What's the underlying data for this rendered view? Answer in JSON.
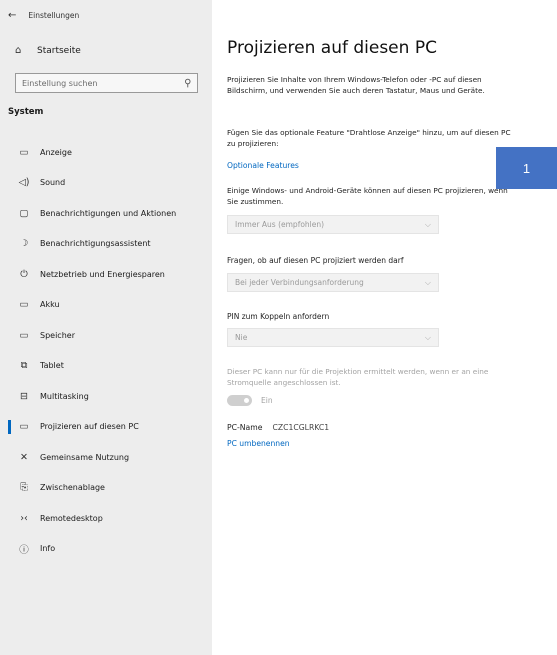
{
  "window": {
    "title": "Einstellungen",
    "back_glyph": "←"
  },
  "sidebar": {
    "home": {
      "label": "Startseite",
      "icon": "⌂"
    },
    "search": {
      "placeholder": "Einstellung suchen",
      "icon": "⚲"
    },
    "section_title": "System",
    "items": [
      {
        "label": "Anzeige",
        "icon": "▭",
        "icon_name": "monitor-icon"
      },
      {
        "label": "Sound",
        "icon": "◁)",
        "icon_name": "speaker-icon"
      },
      {
        "label": "Benachrichtigungen und Aktionen",
        "icon": "▢",
        "icon_name": "notification-icon"
      },
      {
        "label": "Benachrichtigungsassistent",
        "icon": "☽",
        "icon_name": "moon-icon"
      },
      {
        "label": "Netzbetrieb und Energiesparen",
        "icon": "⏻",
        "icon_name": "power-icon"
      },
      {
        "label": "Akku",
        "icon": "▭",
        "icon_name": "battery-icon"
      },
      {
        "label": "Speicher",
        "icon": "▭",
        "icon_name": "storage-icon"
      },
      {
        "label": "Tablet",
        "icon": "⧉",
        "icon_name": "tablet-icon"
      },
      {
        "label": "Multitasking",
        "icon": "⊟",
        "icon_name": "multitasking-icon"
      },
      {
        "label": "Projizieren auf diesen PC",
        "icon": "▭",
        "icon_name": "project-icon",
        "active": true
      },
      {
        "label": "Gemeinsame Nutzung",
        "icon": "✕",
        "icon_name": "share-icon"
      },
      {
        "label": "Zwischenablage",
        "icon": "⎘",
        "icon_name": "clipboard-icon"
      },
      {
        "label": "Remotedesktop",
        "icon": "›‹",
        "icon_name": "remote-desktop-icon"
      },
      {
        "label": "Info",
        "icon": "ⓘ",
        "icon_name": "info-icon"
      }
    ]
  },
  "main": {
    "title": "Projizieren auf diesen PC",
    "intro": "Projizieren Sie Inhalte von Ihrem Windows-Telefon oder -PC auf diesen Bildschirm, und verwenden Sie auch deren Tastatur, Maus und Geräte.",
    "feature_text": "Fügen Sie das optionale Feature \"Drahtlose Anzeige\" hinzu, um auf diesen PC zu projizieren:",
    "feature_link": "Optionale Features",
    "availability_text": "Einige Windows- und Android-Geräte können auf diesen PC projizieren, wenn Sie zustimmen.",
    "availability_value": "Immer Aus (empfohlen)",
    "ask_label": "Fragen, ob auf diesen PC projiziert werden darf",
    "ask_value": "Bei jeder Verbindungsanforderung",
    "pin_label": "PIN zum Koppeln anfordern",
    "pin_value": "Nie",
    "power_note": "Dieser PC kann nur für die Projektion ermittelt werden, wenn er an eine Stromquelle angeschlossen ist.",
    "toggle_label": "Ein",
    "pc_name_key": "PC-Name",
    "pc_name_value": "CZC1CGLRKC1",
    "rename_link": "PC umbenennen",
    "chevron": "⌵"
  },
  "badge": {
    "text": "1",
    "color": "#4472c4"
  },
  "colors": {
    "accent": "#0067c0",
    "sidebar_bg": "#ededed"
  }
}
